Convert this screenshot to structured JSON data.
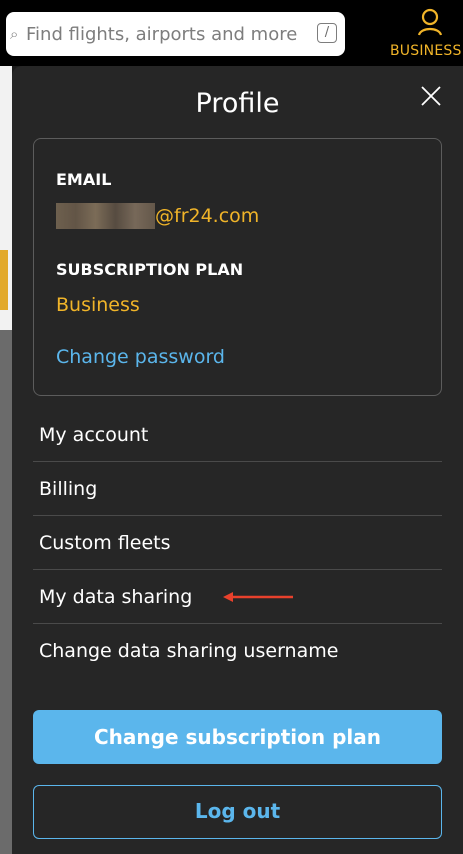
{
  "header": {
    "search": {
      "placeholder": "Find flights, airports and more",
      "shortcut_key": "/"
    },
    "account_button": {
      "label": "BUSINESS",
      "icon": "user-icon"
    }
  },
  "profile": {
    "title": "Profile",
    "close_icon": "close-icon",
    "email_label": "EMAIL",
    "email_visible_part": "@fr24.com",
    "subscription_label": "SUBSCRIPTION PLAN",
    "subscription_value": "Business",
    "change_password_label": "Change password"
  },
  "menu": {
    "items": [
      {
        "label": "My account"
      },
      {
        "label": "Billing"
      },
      {
        "label": "Custom fleets"
      },
      {
        "label": "My data sharing"
      },
      {
        "label": "Change data sharing username"
      }
    ]
  },
  "actions": {
    "change_plan_label": "Change subscription plan",
    "logout_label": "Log out"
  },
  "colors": {
    "accent_yellow": "#f0b429",
    "accent_blue": "#5bb6ec",
    "annotation_red": "#e8412c",
    "panel_bg": "#262626"
  }
}
